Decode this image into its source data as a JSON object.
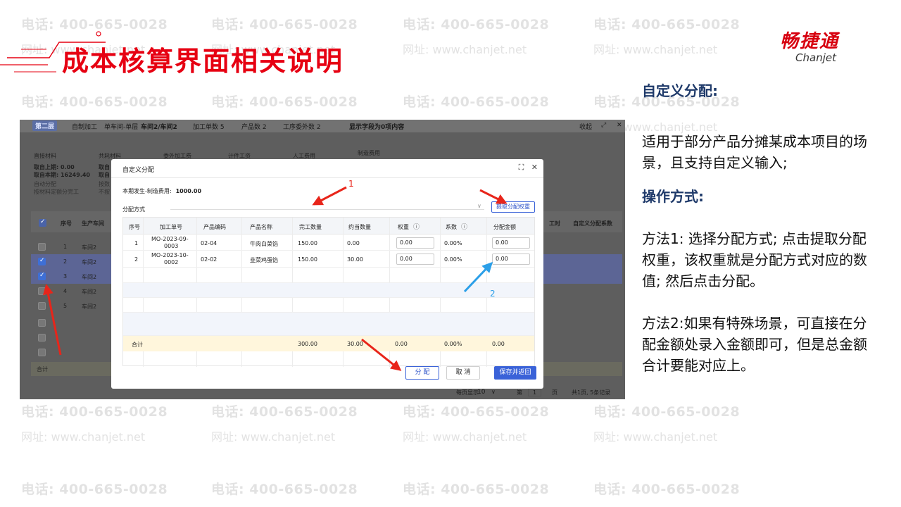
{
  "watermark": {
    "phone": "电话: 400-665-0028",
    "site": "网址: www.chanjet.net"
  },
  "slide": {
    "title": "成本核算界面相关说明",
    "logo_cn": "畅捷通",
    "logo_en": "Chanjet",
    "accent_color": "#e60012"
  },
  "panel": {
    "heading1": "自定义分配:",
    "desc": "适用于部分产品分摊某成本项目的场景，且支持自定义输入;",
    "heading2": "操作方式:",
    "method1": "方法1: 选择分配方式; 点击提取分配权重，该权重就是分配方式对应的数值; 然后点击分配。",
    "method2": "方法2:如果有特殊场景，可直接在分配金额处录入金额即可，但是总金额合计要能对应上。"
  },
  "bg": {
    "tab_badge": "第二层",
    "tab_self": "自制加工",
    "tab_mode": "单车间-单层",
    "workshop": "车间2/车间2",
    "orders": "加工单数 5",
    "products": "产品数 2",
    "outsource": "工序委外数 2",
    "display_fields": "显示字段为0项内容",
    "collapse": "收起",
    "expand_icon": "expand-icon",
    "close_icon": "close-icon",
    "col_direct_material": "直接材料",
    "col_consumables": "共耗材料",
    "col_outsource": "委外加工费",
    "col_piece_wage": "计件工资",
    "col_labor": "人工费用",
    "col_mfg": "制造费用",
    "fetch_last": "取自上期: 0.00",
    "fetch_current": "取自本期: 16249.40",
    "fetch_last_short": "取自",
    "fetch_current_short": "取自",
    "auto_alloc": "自动分配",
    "by_material": "按材料定额分完工",
    "by_short": "按数",
    "not_short": "不按",
    "col_seq": "序号",
    "col_workshop": "生产车间",
    "col_hours": "工时",
    "col_custom_factor": "自定义分配系数",
    "rows": [
      {
        "seq": "1",
        "ws": "车间2"
      },
      {
        "seq": "2",
        "ws": "车间2"
      },
      {
        "seq": "3",
        "ws": "车间2"
      },
      {
        "seq": "4",
        "ws": "车间2"
      },
      {
        "seq": "5",
        "ws": "车间2"
      }
    ],
    "total": "合计",
    "page_size_label": "每页显示",
    "page_size": "10",
    "page_prefix": "第",
    "page_no": "1",
    "page_suffix": "页",
    "summary": "共1页, 5条记录"
  },
  "modal": {
    "title": "自定义分配",
    "fee_label": "本期发生-制造费用:",
    "fee_value": "1000.00",
    "method_label": "分配方式",
    "fetch_weight_button": "提取分配权重",
    "columns": [
      "序号",
      "加工单号",
      "产品编码",
      "产品名称",
      "完工数量",
      "约当数量",
      "权重",
      "系数",
      "分配金额"
    ],
    "rows": [
      {
        "seq": "1",
        "order_l1": "MO-2023-09-",
        "order_l2": "0003",
        "code": "02-04",
        "name": "牛肉白菜馅",
        "done": "150.00",
        "equiv": "0.00",
        "weight": "0.00",
        "factor": "0.00%",
        "amount": "0.00"
      },
      {
        "seq": "2",
        "order_l1": "MO-2023-10-",
        "order_l2": "0002",
        "code": "02-02",
        "name": "韭菜鸡蛋馅",
        "done": "150.00",
        "equiv": "30.00",
        "weight": "0.00",
        "factor": "0.00%",
        "amount": "0.00"
      }
    ],
    "sum": {
      "label": "合计",
      "done": "300.00",
      "equiv": "30.00",
      "weight": "0.00",
      "factor": "0.00%",
      "amount": "0.00"
    },
    "btn_distribute": "分 配",
    "btn_cancel": "取 消",
    "btn_save_return": "保存并返回"
  },
  "annotations": {
    "label1": "1",
    "label2": "2",
    "red": "#e8251a",
    "blue": "#2b9fe8"
  }
}
